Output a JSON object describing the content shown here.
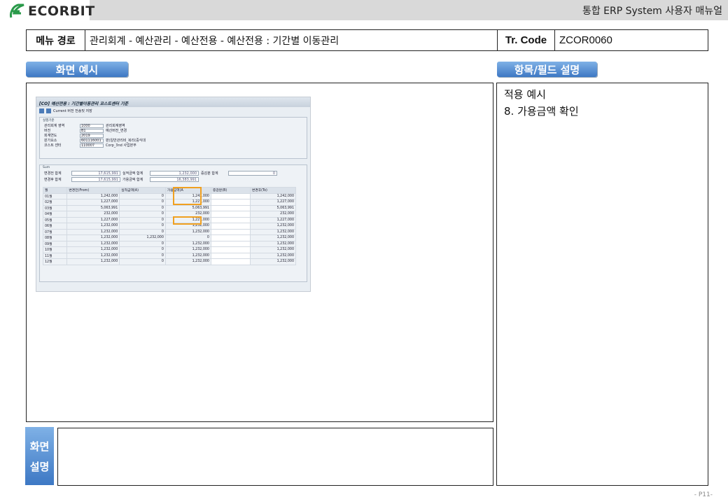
{
  "header": {
    "logo_text": "ECORBIT",
    "title": "통합 ERP System 사용자 매뉴얼"
  },
  "menu_path": {
    "label": "메뉴 경로",
    "value": "관리회계 - 예산관리 - 예산전용 - 예산전용 : 기간별 이동관리",
    "tr_label": "Tr. Code",
    "tr_value": "ZCOR0060"
  },
  "sections": {
    "screen_example": "화면 예시",
    "field_desc": "항목/필드 설명",
    "screen_desc_line1": "화면",
    "screen_desc_line2": "설명"
  },
  "right_panel": {
    "line1": "적용 예시",
    "line2": "8. 가용금액 확인"
  },
  "page_number": "- P11-",
  "sap": {
    "title": "[CO] 예산전용 : 기간별이동관리 코스트센터 기준",
    "toolbar": "Current 버전 전송및 저장",
    "group1_title": "실행기준",
    "fields": [
      {
        "label": "관리회계 영역",
        "value": "1000",
        "desc": "관리회계영역"
      },
      {
        "label": "버전",
        "value": "B1",
        "desc": "예산버전_변경"
      },
      {
        "label": "회계연도",
        "value": "2019",
        "desc": ""
      },
      {
        "label": "원가요소",
        "value": "601116001",
        "desc": "판)일반관리비_복리(중식대"
      },
      {
        "label": "코스트 센터",
        "value": "110007",
        "desc": "Corp_3nd 사업본부"
      }
    ],
    "sum_title": "Sum",
    "sum_rows": [
      {
        "l1": "변경전 합계",
        "v1": "17,615,991",
        "l2": "실적금액 합계",
        "v2": "1,232,000",
        "l3": "증감분 합계",
        "v3": "0"
      },
      {
        "l1": "변경후 합계",
        "v1": "17,615,991",
        "l2": "가용금액 합계",
        "v2": "16,383,991",
        "l3": "",
        "v3": ""
      }
    ],
    "columns": [
      "월",
      "변경전(From)",
      "실적금액(A)",
      "가용금액(A",
      "증감분(B)",
      "변경후(To)"
    ],
    "rows": [
      [
        "01월",
        "1,242,000",
        "0",
        "1,242,000",
        "",
        "1,242,000"
      ],
      [
        "02월",
        "1,227,000",
        "0",
        "1,227,000",
        "",
        "1,227,000"
      ],
      [
        "03월",
        "5,063,991",
        "0",
        "5,063,991",
        "",
        "5,063,991"
      ],
      [
        "04월",
        "232,000",
        "0",
        "232,000",
        "",
        "232,000"
      ],
      [
        "05월",
        "1,227,000",
        "0",
        "1,227,000",
        "",
        "1,227,000"
      ],
      [
        "06월",
        "1,232,000",
        "0",
        "1,232,000",
        "",
        "1,232,000"
      ],
      [
        "07월",
        "1,232,000",
        "0",
        "1,232,000",
        "",
        "1,232,000"
      ],
      [
        "08월",
        "1,232,000",
        "1,232,000",
        "0",
        "",
        "1,232,000"
      ],
      [
        "09월",
        "1,232,000",
        "0",
        "1,232,000",
        "",
        "1,232,000"
      ],
      [
        "10월",
        "1,232,000",
        "0",
        "1,232,000",
        "",
        "1,232,000"
      ],
      [
        "11월",
        "1,232,000",
        "0",
        "1,232,000",
        "",
        "1,232,000"
      ],
      [
        "12월",
        "1,232,000",
        "0",
        "1,232,000",
        "",
        "1,232,000"
      ]
    ]
  },
  "colors": {
    "tab_blue": "#3d78c4",
    "highlight": "#f0a020"
  }
}
